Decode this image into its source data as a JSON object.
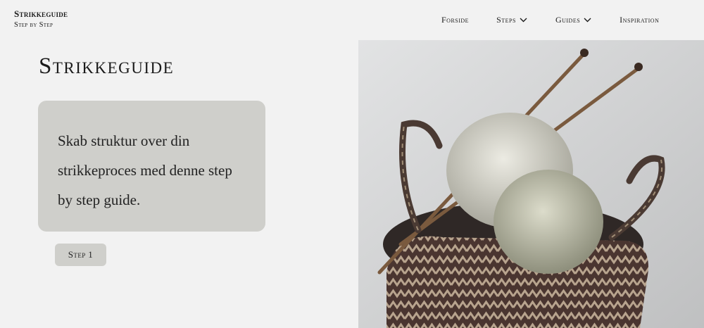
{
  "brand": {
    "title": "Strikkeguide",
    "subtitle": "Step by Step"
  },
  "nav": {
    "forside": "Forside",
    "steps": "Steps",
    "guides": "Guides",
    "inspiration": "Inspiration"
  },
  "hero": {
    "title": "Strikkeguide",
    "card_text": "Skab struktur over din strikkeproces med denne step by step guide.",
    "button_label": "Step 1"
  },
  "icons": {
    "dropdown": "chevron-down-icon"
  },
  "colors": {
    "background": "#f2f2f2",
    "card": "#cfcfcb",
    "text": "#1a1a1a"
  }
}
